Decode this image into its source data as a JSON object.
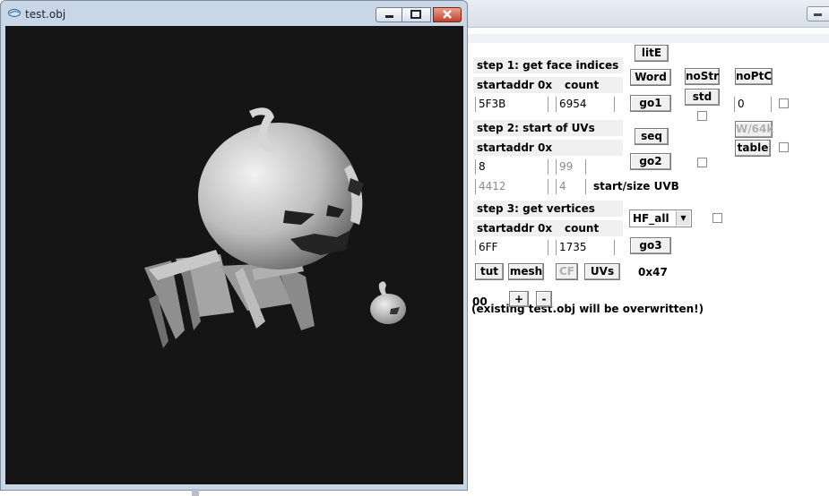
{
  "viewer": {
    "title": "test.obj"
  },
  "tool": {
    "buttons": {
      "lite": "litE",
      "word": "Word",
      "nostr": "noStr",
      "noptc": "noPtC",
      "go1": "go1",
      "std": "std",
      "seq": "seq",
      "w64k": "W/64k",
      "table": "table",
      "go2": "go2",
      "go3": "go3",
      "tut": "tut",
      "mesh": "mesh",
      "cf": "CF",
      "uvs": "UVs",
      "plus": "+",
      "minus": "-"
    },
    "step1": {
      "heading": "step 1: get face indices",
      "startaddr_label": "startaddr 0x",
      "count_label": "count",
      "startaddr": "5F3B",
      "count": "6954"
    },
    "step2": {
      "heading": "step 2: start of UVs",
      "startaddr_label": "startaddr 0x",
      "value_a": "8",
      "value_b": "99",
      "uvb_start": "4412",
      "uvb_size": "4",
      "uvb_label": "start/size UVB"
    },
    "step3": {
      "heading": "step 3: get vertices",
      "startaddr_label": "startaddr 0x",
      "count_label": "count",
      "startaddr": "6FF",
      "count": "1735"
    },
    "field_zero": "0",
    "format_select": "HF_all",
    "hex_value": "0x47",
    "stepper_value": "00",
    "status_message": "(existing test.obj will be overwritten!)"
  }
}
